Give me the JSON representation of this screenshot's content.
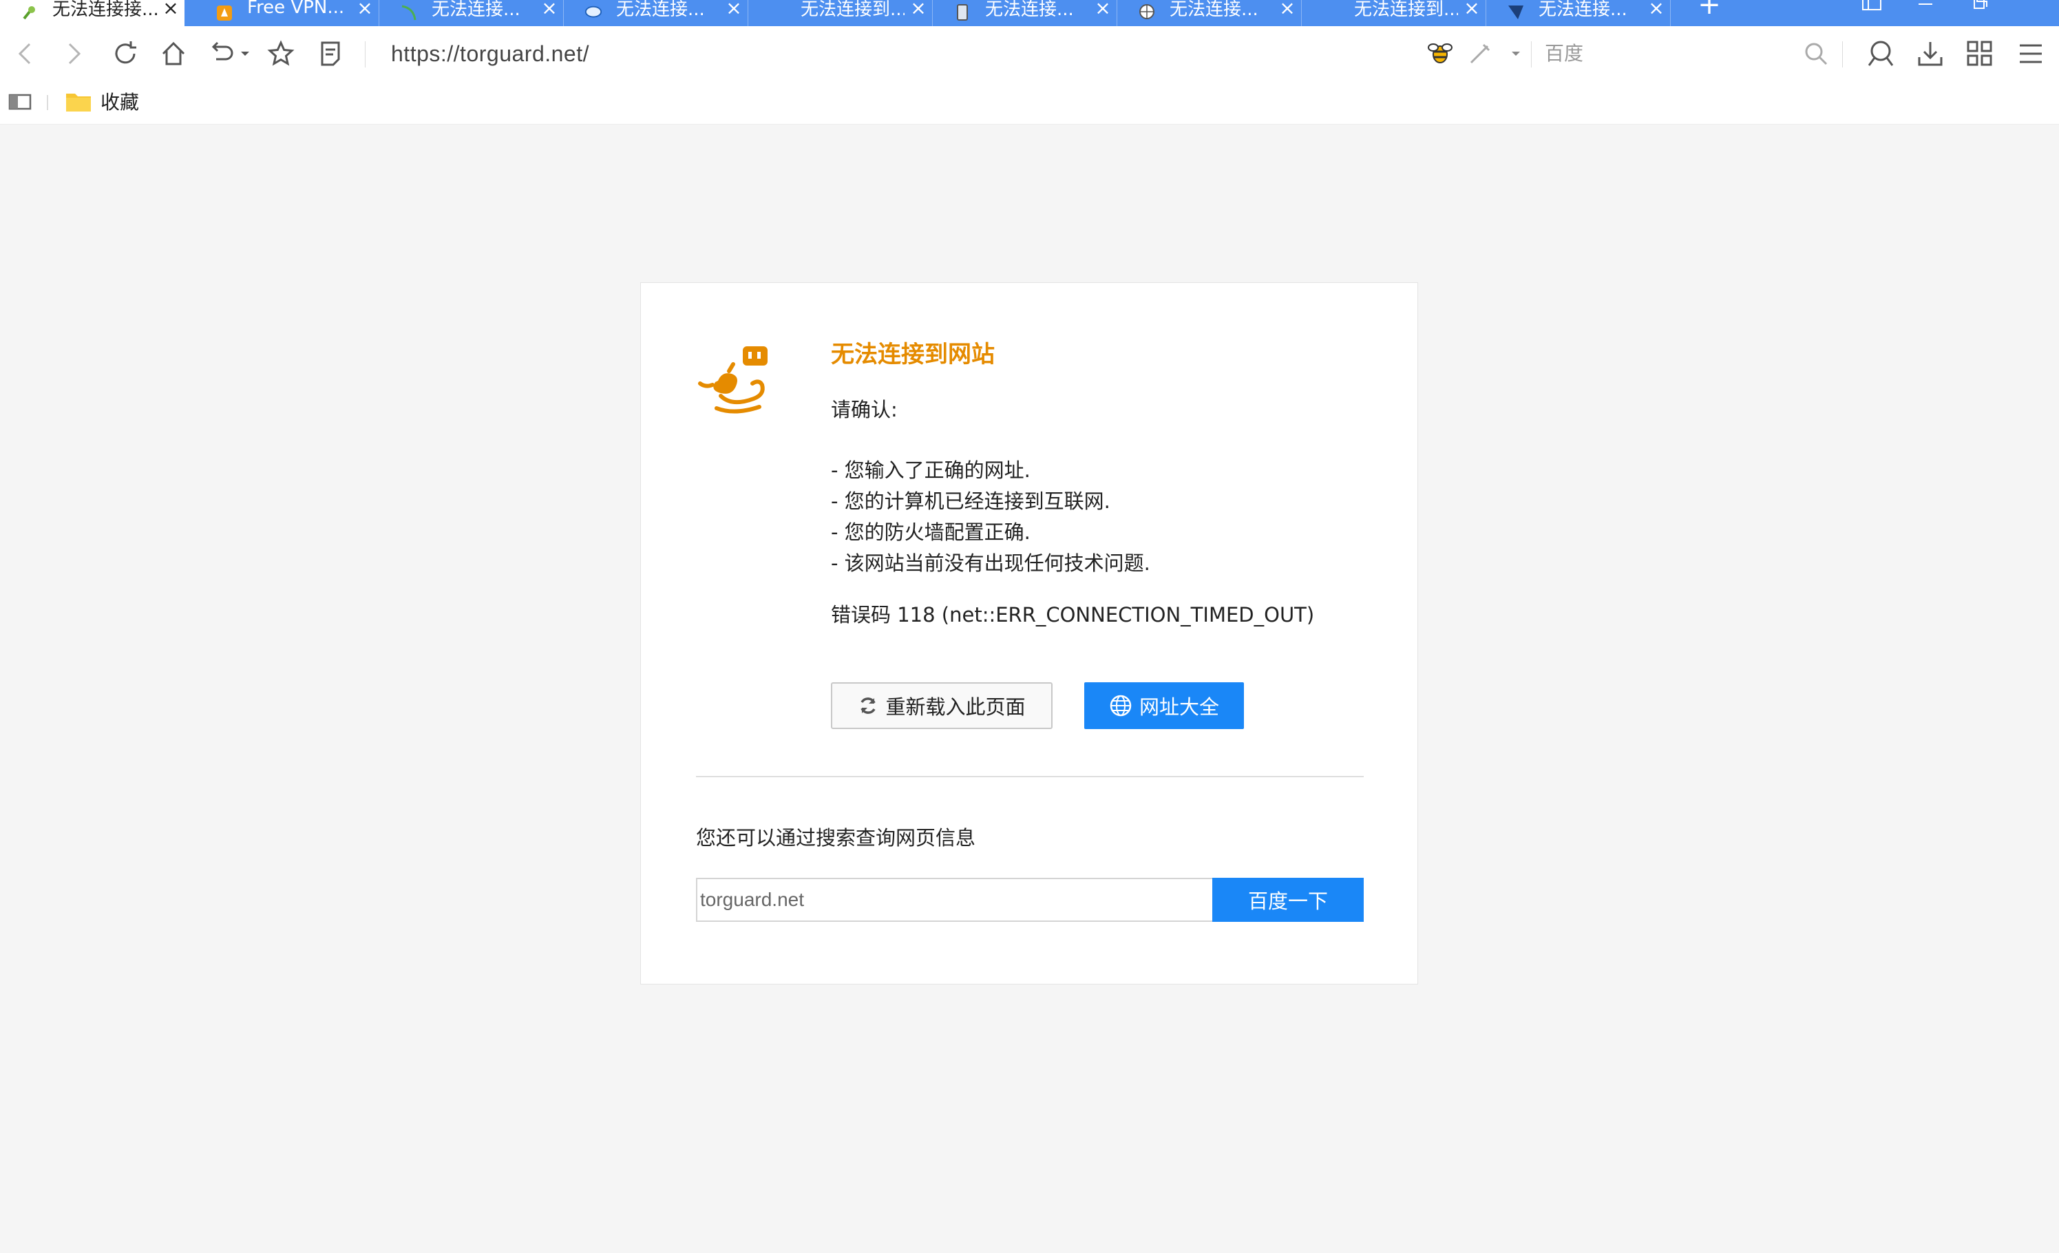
{
  "tabs": [
    {
      "title": "无法连接接...",
      "icon": "plug-favicon",
      "active": true
    },
    {
      "title": "Free VPN...",
      "icon": "vpn-favicon"
    },
    {
      "title": "无法连接...",
      "icon": "leaf-favicon"
    },
    {
      "title": "无法连接...",
      "icon": "cloud-favicon"
    },
    {
      "title": "无法连接到...",
      "icon": "blank-favicon"
    },
    {
      "title": "无法连接...",
      "icon": "phone-favicon"
    },
    {
      "title": "无法连接...",
      "icon": "globe-favicon"
    },
    {
      "title": "无法连接到...",
      "icon": "blank-favicon"
    },
    {
      "title": "无法连接...",
      "icon": "flag-favicon"
    }
  ],
  "tab_close": "×",
  "new_tab": "+",
  "toolbar": {
    "address": "https://torguard.net/",
    "search_placeholder": "百度"
  },
  "bookmarks": {
    "folder_label": "收藏"
  },
  "error": {
    "title": "无法连接到网站",
    "confirm": "请确认:",
    "checks": [
      "- 您输入了正确的网址.",
      "- 您的计算机已经连接到互联网.",
      "- 您的防火墙配置正确.",
      "- 该网站当前没有出现任何技术问题."
    ],
    "code": "错误码 118 (net::ERR_CONNECTION_TIMED_OUT)",
    "reload_label": "重新载入此页面",
    "nav_label": "网址大全",
    "search_hint": "您还可以通过搜索查询网页信息",
    "search_value": "torguard.net",
    "search_button": "百度一下"
  },
  "colors": {
    "tabbar": "#4d8ff0",
    "accent": "#1a87f7",
    "error_title": "#e58b00"
  }
}
